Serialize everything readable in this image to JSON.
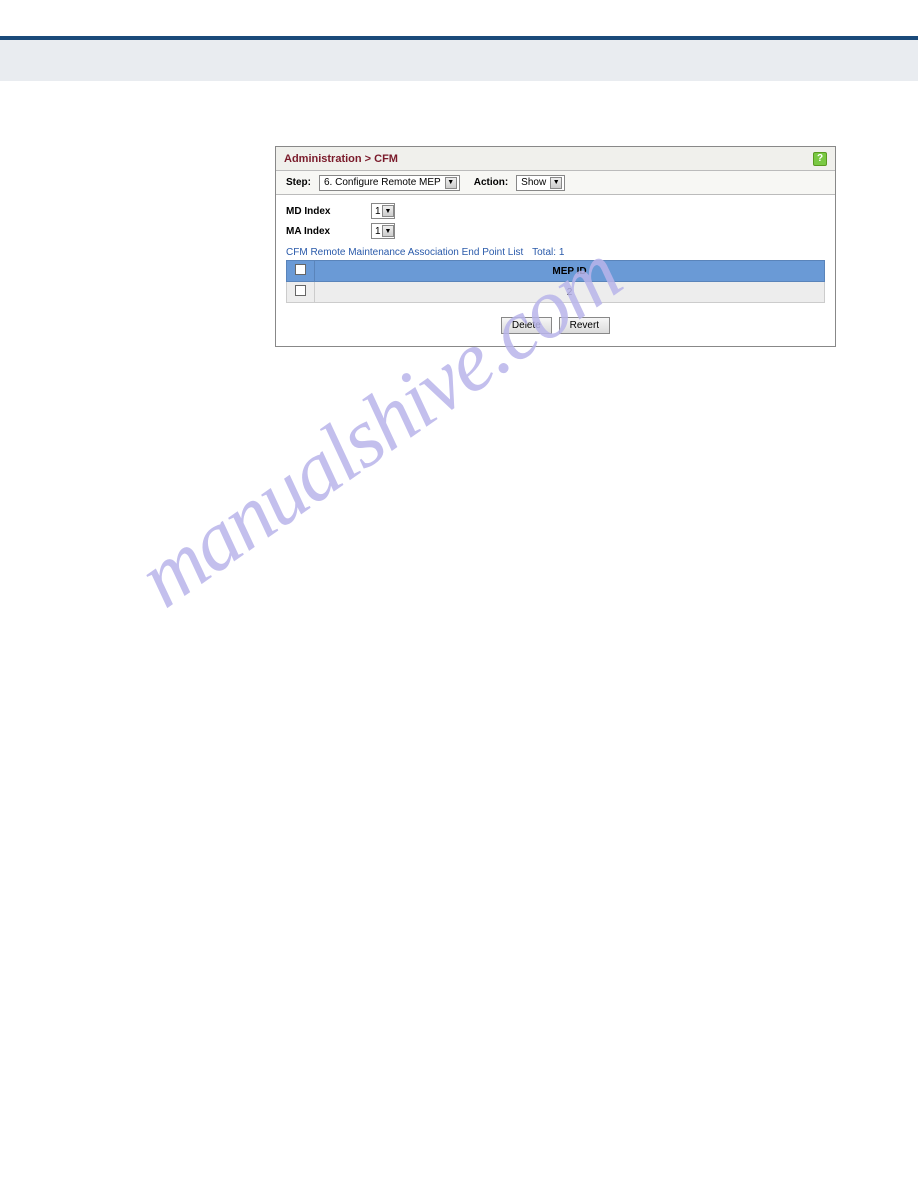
{
  "breadcrumb": "Administration > CFM",
  "help_icon": "?",
  "filter": {
    "step_label": "Step:",
    "step_value": "6. Configure Remote MEP",
    "action_label": "Action:",
    "action_value": "Show"
  },
  "indices": {
    "md_label": "MD Index",
    "md_value": "1",
    "ma_label": "MA Index",
    "ma_value": "1"
  },
  "list": {
    "title": "CFM Remote Maintenance Association End Point List",
    "total_label": "Total:",
    "total_value": "1",
    "columns": [
      "",
      "MEP ID"
    ],
    "rows": [
      [
        "",
        "2"
      ]
    ]
  },
  "buttons": {
    "delete": "Delete",
    "revert": "Revert"
  },
  "watermark": "manualshive.com",
  "dropdown_arrow": "▼"
}
